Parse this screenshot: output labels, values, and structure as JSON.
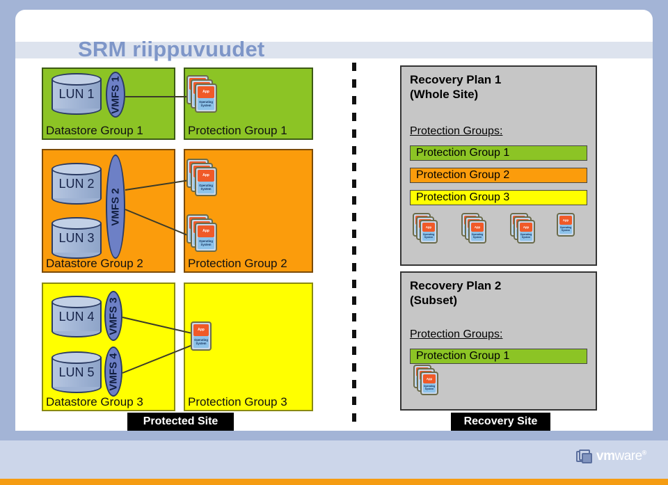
{
  "slide": {
    "title": "SRM riippuvuudet",
    "brand": {
      "name_bold": "vm",
      "name_rest": "ware",
      "trademark": "®",
      "icon": "vmware-logo-icon"
    }
  },
  "site_labels": {
    "protected": "Protected Site",
    "recovery": "Recovery Site"
  },
  "vm_card": {
    "app_label": "App",
    "os_label": "Operating System"
  },
  "protected_site": {
    "rows": [
      {
        "color": "#8cc425",
        "datastore_group_label": "Datastore Group 1",
        "protection_group_label": "Protection Group 1",
        "luns": [
          {
            "label": "LUN 1",
            "vmfs": "VMFS 1"
          }
        ],
        "vm_stacks": [
          {
            "count": 3
          }
        ]
      },
      {
        "color": "#fb9c0c",
        "datastore_group_label": "Datastore Group 2",
        "protection_group_label": "Protection Group 2",
        "luns": [
          {
            "label": "LUN 2",
            "vmfs": "VMFS 2"
          },
          {
            "label": "LUN 3",
            "vmfs": ""
          }
        ],
        "vm_stacks": [
          {
            "count": 3
          },
          {
            "count": 3
          }
        ]
      },
      {
        "color": "#ffff00",
        "datastore_group_label": "Datastore Group 3",
        "protection_group_label": "Protection Group 3",
        "luns": [
          {
            "label": "LUN 4",
            "vmfs": "VMFS 3"
          },
          {
            "label": "LUN 5",
            "vmfs": "VMFS 4"
          }
        ],
        "vm_stacks": [
          {
            "count": 1
          }
        ]
      }
    ]
  },
  "recovery_site": {
    "plans": [
      {
        "title": "Recovery Plan 1\n(Whole Site)",
        "protection_groups_heading": "Protection Groups:",
        "groups": [
          {
            "label": "Protection Group 1",
            "color": "#8cc425"
          },
          {
            "label": "Protection Group 2",
            "color": "#fb9c0c"
          },
          {
            "label": "Protection Group 3",
            "color": "#ffff00"
          }
        ],
        "vm_stacks": [
          {
            "count": 3
          },
          {
            "count": 3
          },
          {
            "count": 3
          },
          {
            "count": 1
          }
        ]
      },
      {
        "title": "Recovery Plan 2\n(Subset)",
        "protection_groups_heading": "Protection Groups:",
        "groups": [
          {
            "label": "Protection Group 1",
            "color": "#8cc425"
          }
        ],
        "vm_stacks": [
          {
            "count": 3
          }
        ]
      }
    ]
  }
}
